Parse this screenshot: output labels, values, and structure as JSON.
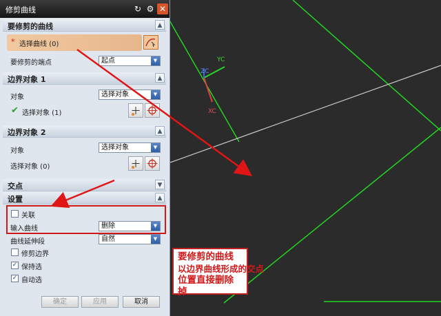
{
  "dialog": {
    "title": "修剪曲线",
    "titlebar_buttons": [
      "reset-icon",
      "gear-icon",
      "close-icon"
    ]
  },
  "section_curve": {
    "title": "要修剪的曲线",
    "select_label": "选择曲线 (0)",
    "endpoint_label": "要修剪的端点",
    "endpoint_value": "起点"
  },
  "section_boundary1": {
    "title": "边界对象 1",
    "object_label": "对象",
    "object_value": "选择对象",
    "select_label": "选择对象 (1)"
  },
  "section_boundary2": {
    "title": "边界对象 2",
    "object_label": "对象",
    "object_value": "选择对象",
    "select_label": "选择对象 (0)"
  },
  "section_intersection": {
    "title": "交点"
  },
  "section_settings": {
    "title": "设置",
    "associative_label": "关联",
    "input_curve_label": "输入曲线",
    "input_curve_value": "删除",
    "extension_label": "曲线延伸段",
    "extension_value": "自然",
    "trim_boundary_label": "修剪边界",
    "keep_label": "保持选",
    "auto_label": "自动选"
  },
  "buttons": {
    "ok": "确定",
    "apply": "应用",
    "cancel": "取消"
  },
  "axes": {
    "xc": "XC",
    "yc": "YC",
    "zc": "ZC"
  },
  "callout": {
    "lines": [
      "要修剪的曲线",
      "以边界曲线形成的交点",
      "位置直接删除掉"
    ]
  },
  "colors": {
    "accent_red": "#d01818",
    "curve_green": "#22d622",
    "background": "#2b2b2b"
  }
}
